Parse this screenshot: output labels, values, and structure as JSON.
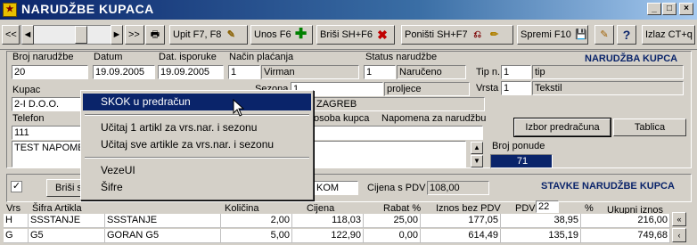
{
  "window": {
    "title": "NARUDŽBE KUPACA",
    "controls": {
      "minimize": "_",
      "maximize": "□",
      "close": "×"
    }
  },
  "toolbar": {
    "nav_first": "<<",
    "nav_prev": "◄",
    "nav_next": "►",
    "nav_last": ">>",
    "print_label": "Upit F7, F8",
    "new_label": "Unos F6",
    "delete_label": "Briši  SH+F6",
    "cancel_label": "Poništi SH+F7",
    "save_label": "Spremi F10",
    "help_label": "?",
    "exit_label": "Izlaz CT+q"
  },
  "header": {
    "section_title": "NARUDŽBA KUPCA",
    "broj_narudzbe": {
      "label": "Broj narudžbe",
      "value": "20"
    },
    "datum": {
      "label": "Datum",
      "value": "19.09.2005"
    },
    "dat_isporuke": {
      "label": "Dat. isporuke",
      "value": "19.09.2005"
    },
    "nacin_placanja": {
      "label": "Način plaćanja",
      "code": "1",
      "value": "Virman"
    },
    "status": {
      "label": "Status narudžbe",
      "code": "1",
      "value": "Naručeno"
    },
    "tip": {
      "label": "Tip n.",
      "code": "1",
      "value": "tip"
    },
    "vrsta": {
      "label": "Vrsta",
      "code": "1",
      "value": "Tekstil"
    },
    "kupac": {
      "label": "Kupac",
      "value": "2-I D.O.O."
    },
    "sezona": {
      "label": "Sezona",
      "code": "1",
      "value": "proljece"
    },
    "mjesto": {
      "value": "ZAGREB"
    },
    "telefon": {
      "label": "Telefon",
      "value": "111"
    },
    "osoba_kupca": {
      "label": "osoba kupca"
    },
    "napomena_label": "Napomena za narudžbu",
    "napomena_text": "TEST NAPOMENA",
    "izbor_predracuna": "Izbor predračuna",
    "tablica": "Tablica",
    "broj_ponude": {
      "label": "Broj ponude",
      "value": "71"
    }
  },
  "context_menu": {
    "items": [
      "SKOK u predračun",
      "Učitaj 1 artikl za vrs.nar. i sezonu",
      "Učitaj sve artikle za vrs.nar. i sezonu",
      "VezeUI",
      "Šifre"
    ]
  },
  "items_panel": {
    "section_title": "STAVKE NARUDŽBE KUPCA",
    "delete_button": "Briši s",
    "field_frag": "KOM",
    "cijena_pdv_label": "Cijena s PDV",
    "cijena_pdv_value": "108,00",
    "pdv_percent": "22",
    "percent_sign": "%",
    "columns": [
      "Vrs",
      "Šifra Artikla",
      "Količina",
      "Cijena",
      "Rabat %",
      "Iznos bez PDV",
      "PDV",
      "Ukupni iznos"
    ],
    "rows": [
      {
        "vrs": "H",
        "sifra": "SSSTANJE",
        "naziv": "SSSTANJE",
        "kolicina": "2,00",
        "cijena": "118,03",
        "rabat": "25,00",
        "iznos": "177,05",
        "pdv": "38,95",
        "ukupno": "216,00"
      },
      {
        "vrs": "G",
        "sifra": "G5",
        "naziv": "GORAN G5",
        "kolicina": "5,00",
        "cijena": "122,90",
        "rabat": "0,00",
        "iznos": "614,49",
        "pdv": "135,19",
        "ukupno": "749,68"
      }
    ]
  },
  "colors": {
    "title_gradient_start": "#0a246a",
    "menu_highlight": "#0a246a",
    "accent_blue": "#0a246a"
  }
}
